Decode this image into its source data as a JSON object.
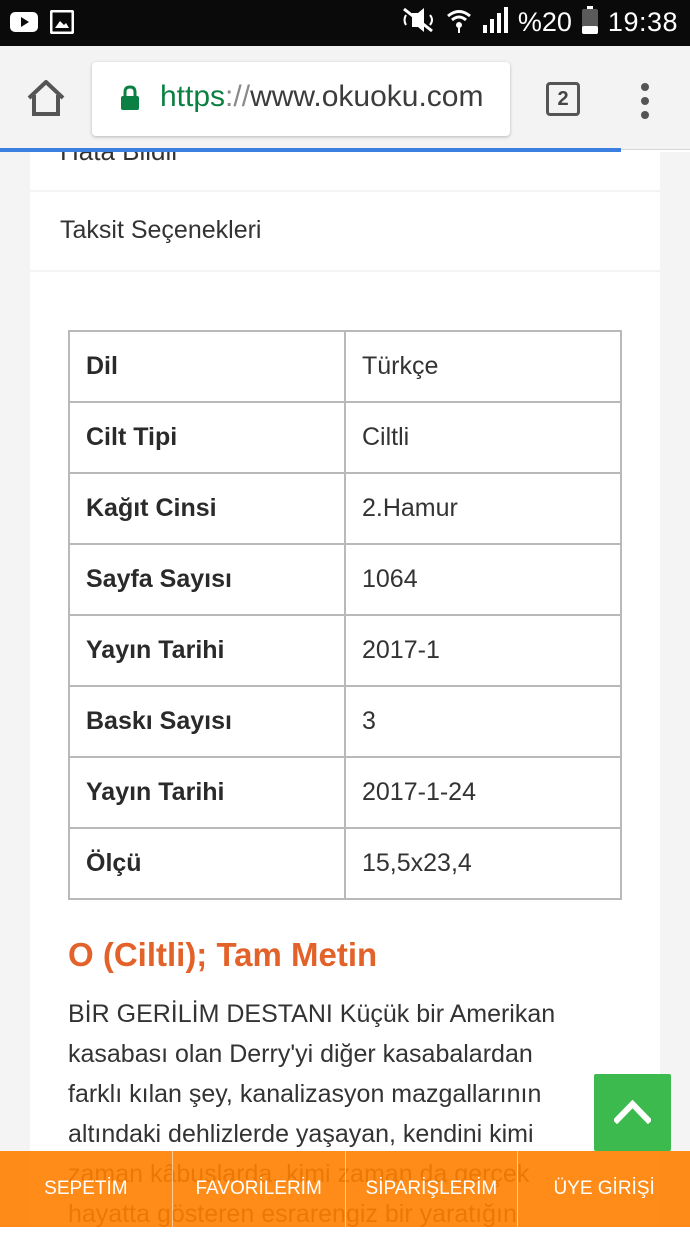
{
  "status_bar": {
    "battery_percent": "%20",
    "time": "19:38",
    "icons": [
      "youtube-icon",
      "image-icon",
      "mute-icon",
      "wifi-icon",
      "signal-icon",
      "battery-icon"
    ]
  },
  "browser": {
    "url_scheme": "https",
    "url_separator": "://",
    "url_host": "www.okuoku.com",
    "tab_count": "2",
    "load_progress": 0.9,
    "secure_color": "#0b8043"
  },
  "info_menu": {
    "report_error": "Hata Bildir",
    "installments": "Taksit Seçenekleri"
  },
  "specs": [
    {
      "label": "Dil",
      "value": "Türkçe"
    },
    {
      "label": "Cilt Tipi",
      "value": "Ciltli"
    },
    {
      "label": "Kağıt Cinsi",
      "value": "2.Hamur"
    },
    {
      "label": "Sayfa Sayısı",
      "value": "1064"
    },
    {
      "label": "Yayın Tarihi",
      "value": "2017-1"
    },
    {
      "label": "Baskı Sayısı",
      "value": "3"
    },
    {
      "label": "Yayın Tarihi",
      "value": "2017-1-24"
    },
    {
      "label": "Ölçü",
      "value": "15,5x23,4"
    }
  ],
  "book": {
    "title": "O (Ciltli); Tam Metin",
    "title_color": "#e2622a",
    "description": "BİR GERİLİM DESTANI Küçük bir Amerikan kasabası olan Derry'yi diğer kasabalardan farklı kılan şey, kanalizasyon mazgallarının altındaki dehlizlerde yaşayan, kendini kimi zaman kâbuslarda, kimi zaman da gerçek hayatta gösteren esrarengiz bir yaratığın"
  },
  "scroll_top": {
    "icon": "chevron-up-icon",
    "color": "#3cba4e"
  },
  "bottom_nav": {
    "color": "#ff8000",
    "items": [
      "SEPETİM",
      "FAVORİLERİM",
      "SİPARİŞLERİM",
      "ÜYE GİRİŞİ"
    ]
  }
}
